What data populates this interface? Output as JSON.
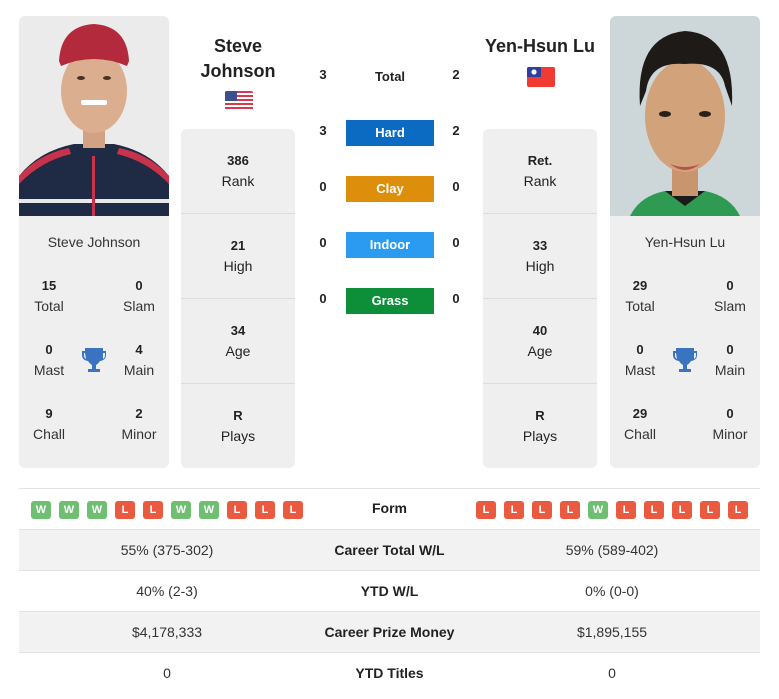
{
  "player1": {
    "name": "Steve Johnson",
    "name_line1": "Steve",
    "name_line2": "Johnson",
    "flag": "usa-flag",
    "titles": {
      "total": {
        "value": "15",
        "label": "Total"
      },
      "slam": {
        "value": "0",
        "label": "Slam"
      },
      "mast": {
        "value": "0",
        "label": "Mast"
      },
      "main": {
        "value": "4",
        "label": "Main"
      },
      "chall": {
        "value": "9",
        "label": "Chall"
      },
      "minor": {
        "value": "2",
        "label": "Minor"
      }
    },
    "stats": [
      {
        "value": "386",
        "label": "Rank"
      },
      {
        "value": "21",
        "label": "High"
      },
      {
        "value": "34",
        "label": "Age"
      },
      {
        "value": "R",
        "label": "Plays"
      }
    ],
    "form": [
      "W",
      "W",
      "W",
      "L",
      "L",
      "W",
      "W",
      "L",
      "L",
      "L"
    ]
  },
  "player2": {
    "name": "Yen-Hsun Lu",
    "flag": "taiwan-flag",
    "titles": {
      "total": {
        "value": "29",
        "label": "Total"
      },
      "slam": {
        "value": "0",
        "label": "Slam"
      },
      "mast": {
        "value": "0",
        "label": "Mast"
      },
      "main": {
        "value": "0",
        "label": "Main"
      },
      "chall": {
        "value": "29",
        "label": "Chall"
      },
      "minor": {
        "value": "0",
        "label": "Minor"
      }
    },
    "stats": [
      {
        "value": "Ret.",
        "label": "Rank"
      },
      {
        "value": "33",
        "label": "High"
      },
      {
        "value": "40",
        "label": "Age"
      },
      {
        "value": "R",
        "label": "Plays"
      }
    ],
    "form": [
      "L",
      "L",
      "L",
      "L",
      "W",
      "L",
      "L",
      "L",
      "L",
      "L"
    ]
  },
  "h2h": {
    "total": {
      "label": "Total",
      "p1": "3",
      "p2": "2"
    },
    "surfaces": [
      {
        "label": "Hard",
        "p1": "3",
        "p2": "2",
        "color": "#0b6bc2"
      },
      {
        "label": "Clay",
        "p1": "0",
        "p2": "0",
        "color": "#dd8f0c"
      },
      {
        "label": "Indoor",
        "p1": "0",
        "p2": "0",
        "color": "#2a9bf0"
      },
      {
        "label": "Grass",
        "p1": "0",
        "p2": "0",
        "color": "#0d8f3a"
      }
    ]
  },
  "form_label": "Form",
  "comparison": [
    {
      "label": "Career Total W/L",
      "p1": "55% (375-302)",
      "p2": "59% (589-402)"
    },
    {
      "label": "YTD W/L",
      "p1": "40% (2-3)",
      "p2": "0% (0-0)"
    },
    {
      "label": "Career Prize Money",
      "p1": "$4,178,333",
      "p2": "$1,895,155"
    },
    {
      "label": "YTD Titles",
      "p1": "0",
      "p2": "0"
    }
  ]
}
